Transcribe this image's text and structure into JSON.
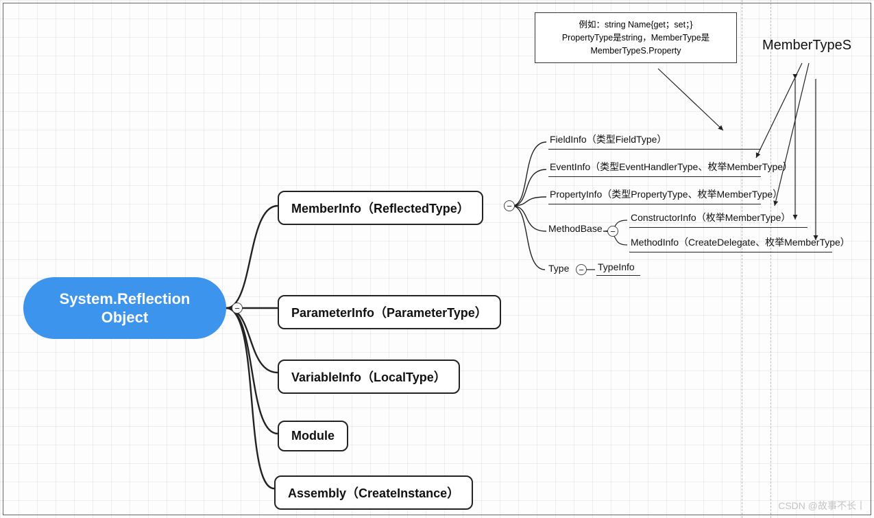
{
  "root": {
    "line1": "System.Reflection",
    "line2": "Object"
  },
  "children": [
    {
      "label": "MemberInfo（ReflectedType）"
    },
    {
      "label": "ParameterInfo（ParameterType）"
    },
    {
      "label": "VariableInfo（LocalType）"
    },
    {
      "label": "Module"
    },
    {
      "label": "Assembly（CreateInstance）"
    }
  ],
  "member_children": [
    {
      "label": "FieldInfo（类型FieldType）"
    },
    {
      "label": "EventInfo（类型EventHandlerType、枚举MemberType）"
    },
    {
      "label": "PropertyInfo（类型PropertyType、枚举MemberType）"
    },
    {
      "label": "MethodBase"
    },
    {
      "label": "Type"
    }
  ],
  "methodbase_children": [
    {
      "label": "ConstructorInfo（枚举MemberType）"
    },
    {
      "label": "MethodInfo（CreateDelegate、枚举MemberType）"
    }
  ],
  "type_child": {
    "label": "TypeInfo"
  },
  "external_label": "MemberTypeS",
  "callout": {
    "line1": "例如：string Name{get；set；}",
    "line2": "PropertyType是string，MemberType是",
    "line3": "MemberTypeS.Property"
  },
  "toggles": {
    "collapse": "−"
  },
  "watermark": "CSDN @故事不长丨"
}
